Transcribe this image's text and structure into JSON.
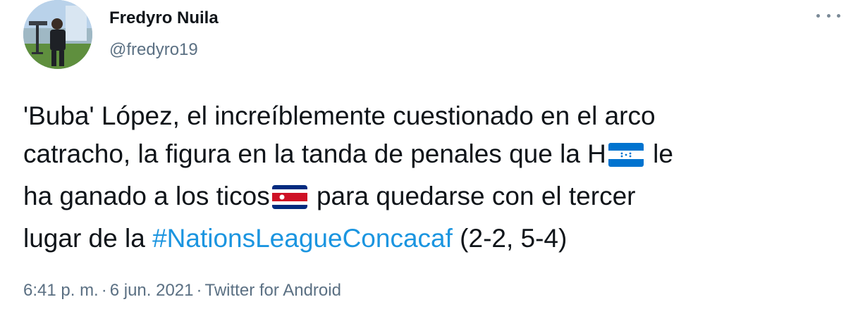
{
  "user": {
    "display_name": "Fredyro Nuila",
    "handle": "@fredyro19"
  },
  "tweet": {
    "line1": "'Buba' López, el increíblemente cuestionado en el arco",
    "line2_a": "catracho, la figura en la tanda de penales que la H",
    "line2_b": " le",
    "line3_a": "ha ganado a los ticos",
    "line3_b": " para quedarse con el tercer",
    "line4_a": "lugar de la ",
    "hashtag": "#NationsLeagueConcacaf",
    "line4_b": " (2-2, 5-4)",
    "flags": [
      "honduras-flag-emoji",
      "costa-rica-flag-emoji"
    ]
  },
  "meta": {
    "time": "6:41 p. m.",
    "separator": "·",
    "date": "6 jun. 2021",
    "client": "Twitter for Android"
  },
  "colors": {
    "link": "#1b95e0",
    "secondary_text": "#5b7083",
    "primary_text": "#0f1419"
  }
}
